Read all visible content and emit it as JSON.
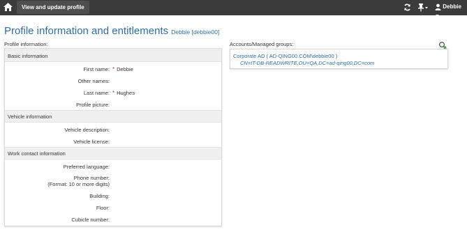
{
  "topbar": {
    "tab_label": "View and update profile",
    "user_label": "Debbie"
  },
  "page": {
    "title": "Profile information and entitlements",
    "subtitle": "Debbie [debbie00]"
  },
  "profile": {
    "heading": "Profile information:",
    "groups": [
      {
        "title": "Basic information",
        "fields": [
          {
            "label": "First name:",
            "value": "Debbie",
            "required": true
          },
          {
            "label": "Other names:",
            "value": ""
          },
          {
            "label": "Last name:",
            "value": "Hughes",
            "required": true
          },
          {
            "label": "Profile picture:",
            "value": ""
          }
        ]
      },
      {
        "title": "Vehicle information",
        "fields": [
          {
            "label": "Vehicle description:",
            "value": ""
          },
          {
            "label": "Vehicle license:",
            "value": ""
          }
        ]
      },
      {
        "title": "Work contact information",
        "fields": [
          {
            "label": "Preferred language:",
            "value": ""
          },
          {
            "label": "Phone number:",
            "label2": "(Format: 10 or more digits)",
            "value": ""
          },
          {
            "label": "Building:",
            "value": ""
          },
          {
            "label": "Floor:",
            "value": ""
          },
          {
            "label": "Cubicle number:",
            "value": ""
          }
        ]
      }
    ],
    "required_mark": "*"
  },
  "accounts": {
    "heading": "Accounts/Managed groups:",
    "line1": "Corporate AD ( AD-QING00.COM\\debbie00 )",
    "line2": "CN=IT-DB-READWRITE,OU=QA,DC=ad-qing00,DC=com"
  },
  "icons": {
    "home": "home-icon",
    "refresh": "refresh-icon",
    "pin": "pin-icon",
    "user": "user-icon",
    "manage": "search-group-icon"
  },
  "colors": {
    "topbar": "#3b3b3b",
    "accent": "#2f6ea3",
    "required": "#c0392b"
  }
}
